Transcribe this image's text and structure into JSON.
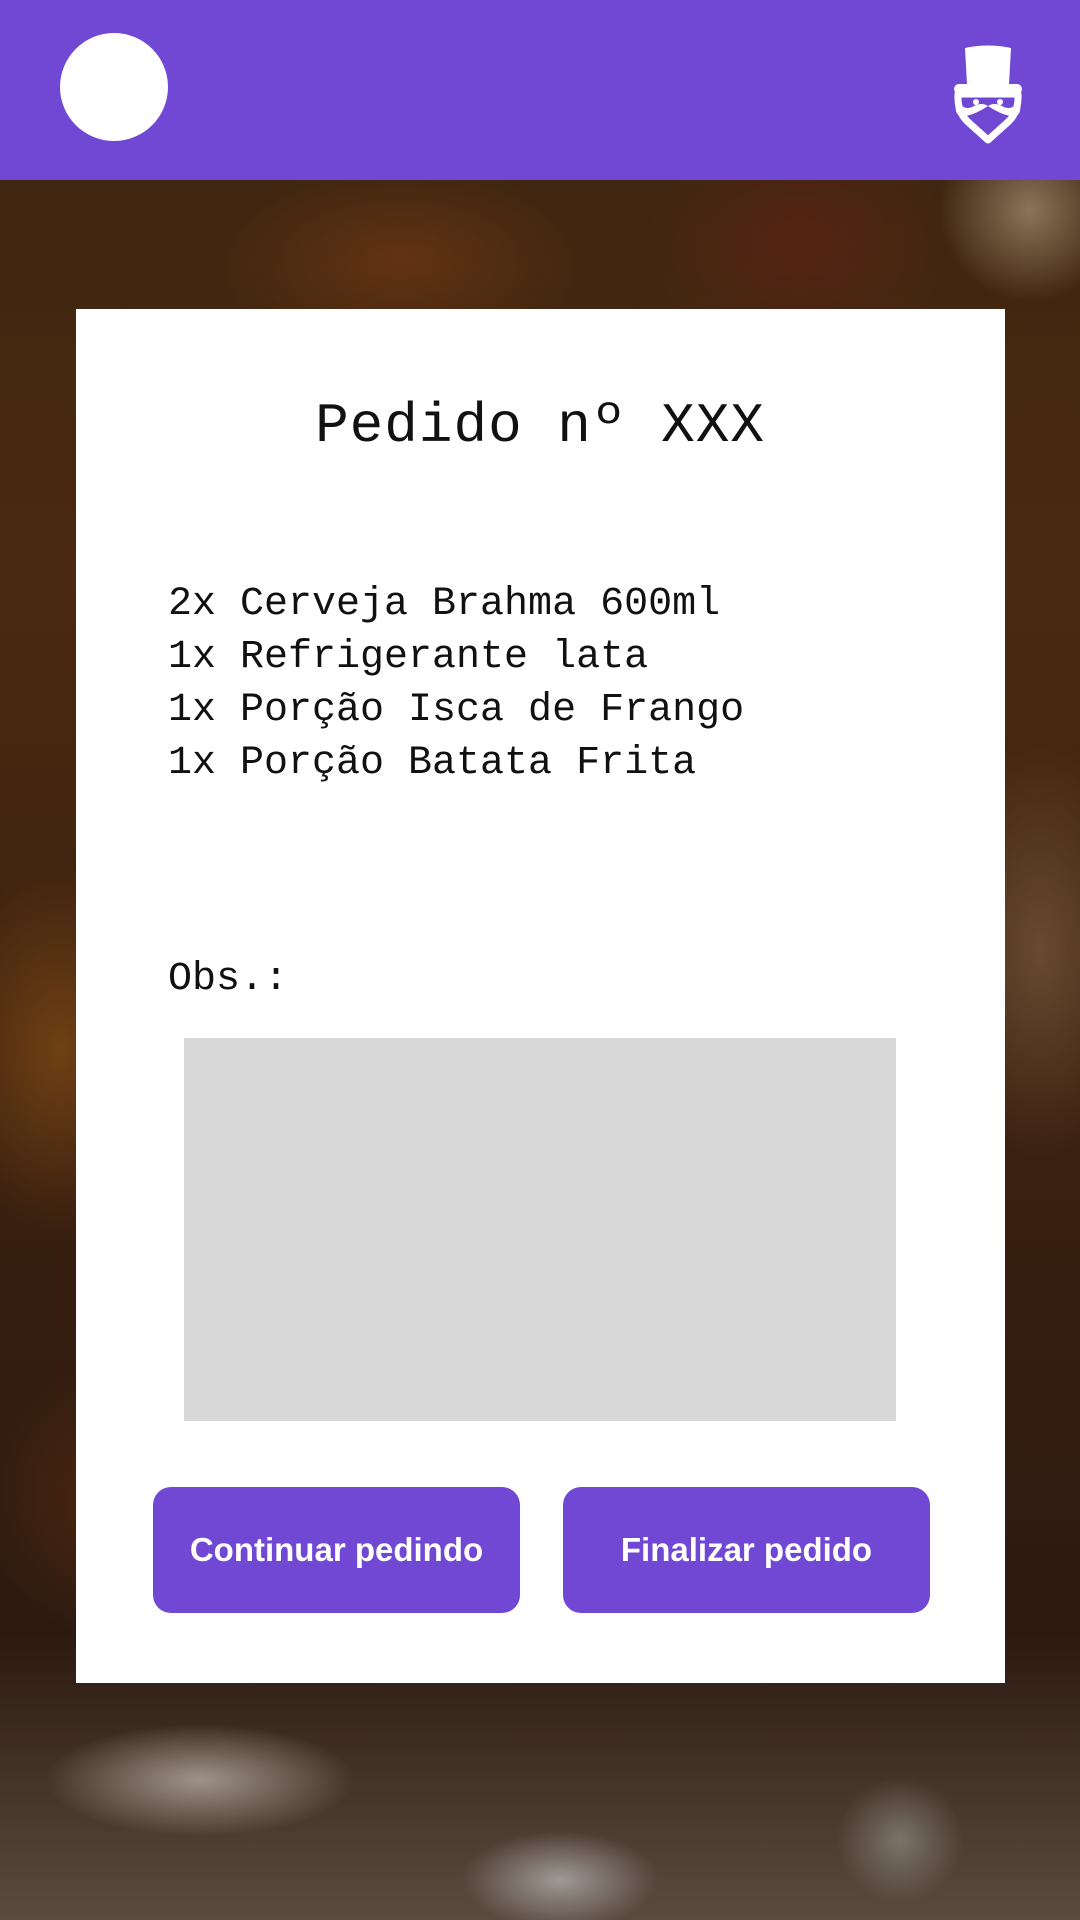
{
  "header": {
    "avatar_icon": "avatar-placeholder",
    "logo_icon": "top-hat-mustache-icon",
    "accent_color": "#7048d4"
  },
  "order": {
    "title": "Pedido nº XXX",
    "items": [
      "2x Cerveja Brahma 600ml",
      "1x Refrigerante lata",
      "1x Porção Isca de Frango",
      "1x Porção Batata Frita"
    ],
    "obs_label": "Obs.:",
    "obs_value": ""
  },
  "actions": {
    "continue_label": "Continuar pedindo",
    "finish_label": "Finalizar pedido"
  }
}
